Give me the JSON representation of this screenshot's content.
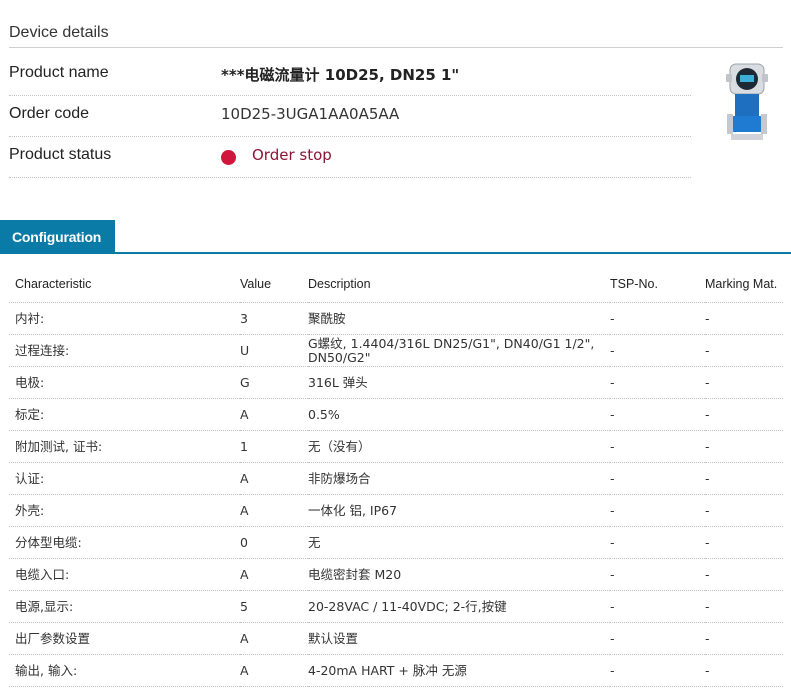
{
  "device": {
    "section_title": "Device details",
    "product_name_label": "Product name",
    "product_name": "***电磁流量计 10D25, DN25 1\"",
    "order_code_label": "Order code",
    "order_code": "10D25-3UGA1AA0A5AA",
    "status_label": "Product status",
    "status": "Order stop",
    "status_color": "#d0163a"
  },
  "config": {
    "tab_label": "Configuration",
    "accent_color": "#0a7ba7",
    "columns": [
      "Characteristic",
      "Value",
      "Description",
      "TSP-No.",
      "Marking Mat."
    ],
    "rows": [
      [
        "内衬:",
        "3",
        "聚酰胺",
        "-",
        "-"
      ],
      [
        "过程连接:",
        "U",
        "G螺纹, 1.4404/316L DN25/G1\", DN40/G1 1/2\", DN50/G2\"",
        "-",
        "-"
      ],
      [
        "电极:",
        "G",
        "316L 弹头",
        "-",
        "-"
      ],
      [
        "标定:",
        "A",
        "0.5%",
        "-",
        "-"
      ],
      [
        "附加测试, 证书:",
        "1",
        "无（没有）",
        "-",
        "-"
      ],
      [
        "认证:",
        "A",
        "非防爆场合",
        "-",
        "-"
      ],
      [
        "外壳:",
        "A",
        "一体化 铝, IP67",
        "-",
        "-"
      ],
      [
        "分体型电缆:",
        "0",
        "无",
        "-",
        "-"
      ],
      [
        "电缆入口:",
        "A",
        "电缆密封套 M20",
        "-",
        "-"
      ],
      [
        "电源,显示:",
        "5",
        "20-28VAC / 11-40VDC; 2-行,按键",
        "-",
        "-"
      ],
      [
        "出厂参数设置",
        "A",
        "默认设置",
        "-",
        "-"
      ],
      [
        "输出, 输入:",
        "A",
        "4-20mA HART + 脉冲 无源",
        "-",
        "-"
      ]
    ]
  }
}
